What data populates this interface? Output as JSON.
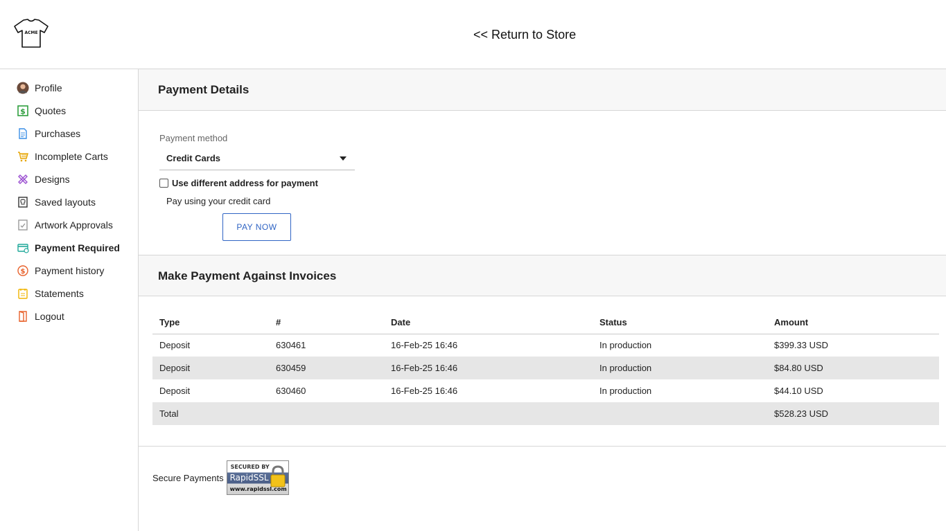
{
  "header": {
    "logo_text": "ACME",
    "return_link": "<< Return to Store"
  },
  "sidebar": {
    "items": [
      {
        "label": "Profile",
        "icon": "avatar-icon"
      },
      {
        "label": "Quotes",
        "icon": "dollar-icon",
        "color": "#2e9e3e"
      },
      {
        "label": "Purchases",
        "icon": "document-icon",
        "color": "#3a8ee6"
      },
      {
        "label": "Incomplete Carts",
        "icon": "cart-icon",
        "color": "#e6a400"
      },
      {
        "label": "Designs",
        "icon": "design-icon",
        "color": "#9b4fd1"
      },
      {
        "label": "Saved layouts",
        "icon": "layout-icon",
        "color": "#333333"
      },
      {
        "label": "Artwork Approvals",
        "icon": "approval-icon",
        "color": "#999999"
      },
      {
        "label": "Payment Required",
        "icon": "card-icon",
        "color": "#1fa89a",
        "active": true
      },
      {
        "label": "Payment history",
        "icon": "coin-icon",
        "color": "#e8622c"
      },
      {
        "label": "Statements",
        "icon": "statement-icon",
        "color": "#f0b400"
      },
      {
        "label": "Logout",
        "icon": "logout-icon",
        "color": "#e8622c"
      }
    ]
  },
  "payment_details": {
    "title": "Payment Details",
    "method_label": "Payment method",
    "method_value": "Credit Cards",
    "checkbox_label": "Use different address for payment",
    "pay_text": "Pay using your credit card",
    "pay_button": "PAY NOW"
  },
  "invoices": {
    "title": "Make Payment Against Invoices",
    "columns": [
      "Type",
      "#",
      "Date",
      "Status",
      "Amount"
    ],
    "rows": [
      [
        "Deposit",
        "630461",
        "16-Feb-25 16:46",
        "In production",
        "$399.33 USD"
      ],
      [
        "Deposit",
        "630459",
        "16-Feb-25 16:46",
        "In production",
        "$84.80 USD"
      ],
      [
        "Deposit",
        "630460",
        "16-Feb-25 16:46",
        "In production",
        "$44.10 USD"
      ]
    ],
    "total_label": "Total",
    "total_amount": "$528.23 USD"
  },
  "secure": {
    "label": "Secure Payments",
    "badge_line1": "SECURED BY",
    "badge_line2": "RapidSSL",
    "badge_line3": "www.rapidssl.com"
  },
  "colors": {
    "accent": "#2f64c4",
    "border": "#d6d6d6",
    "row_alt": "#e6e6e6"
  }
}
